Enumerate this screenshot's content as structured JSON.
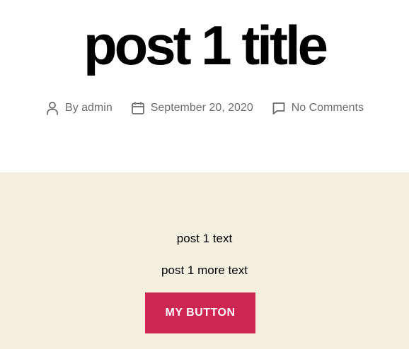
{
  "post": {
    "title": "post 1 title",
    "meta": {
      "author": "By admin",
      "date": "September 20, 2020",
      "comments": "No Comments"
    }
  },
  "content": {
    "paragraphs": [
      "post 1 text",
      "post 1 more text"
    ],
    "button_label": "MY BUTTON"
  },
  "colors": {
    "accent": "#cd2653",
    "content_background": "#f5efe0",
    "meta_text": "#6d6d6d"
  }
}
